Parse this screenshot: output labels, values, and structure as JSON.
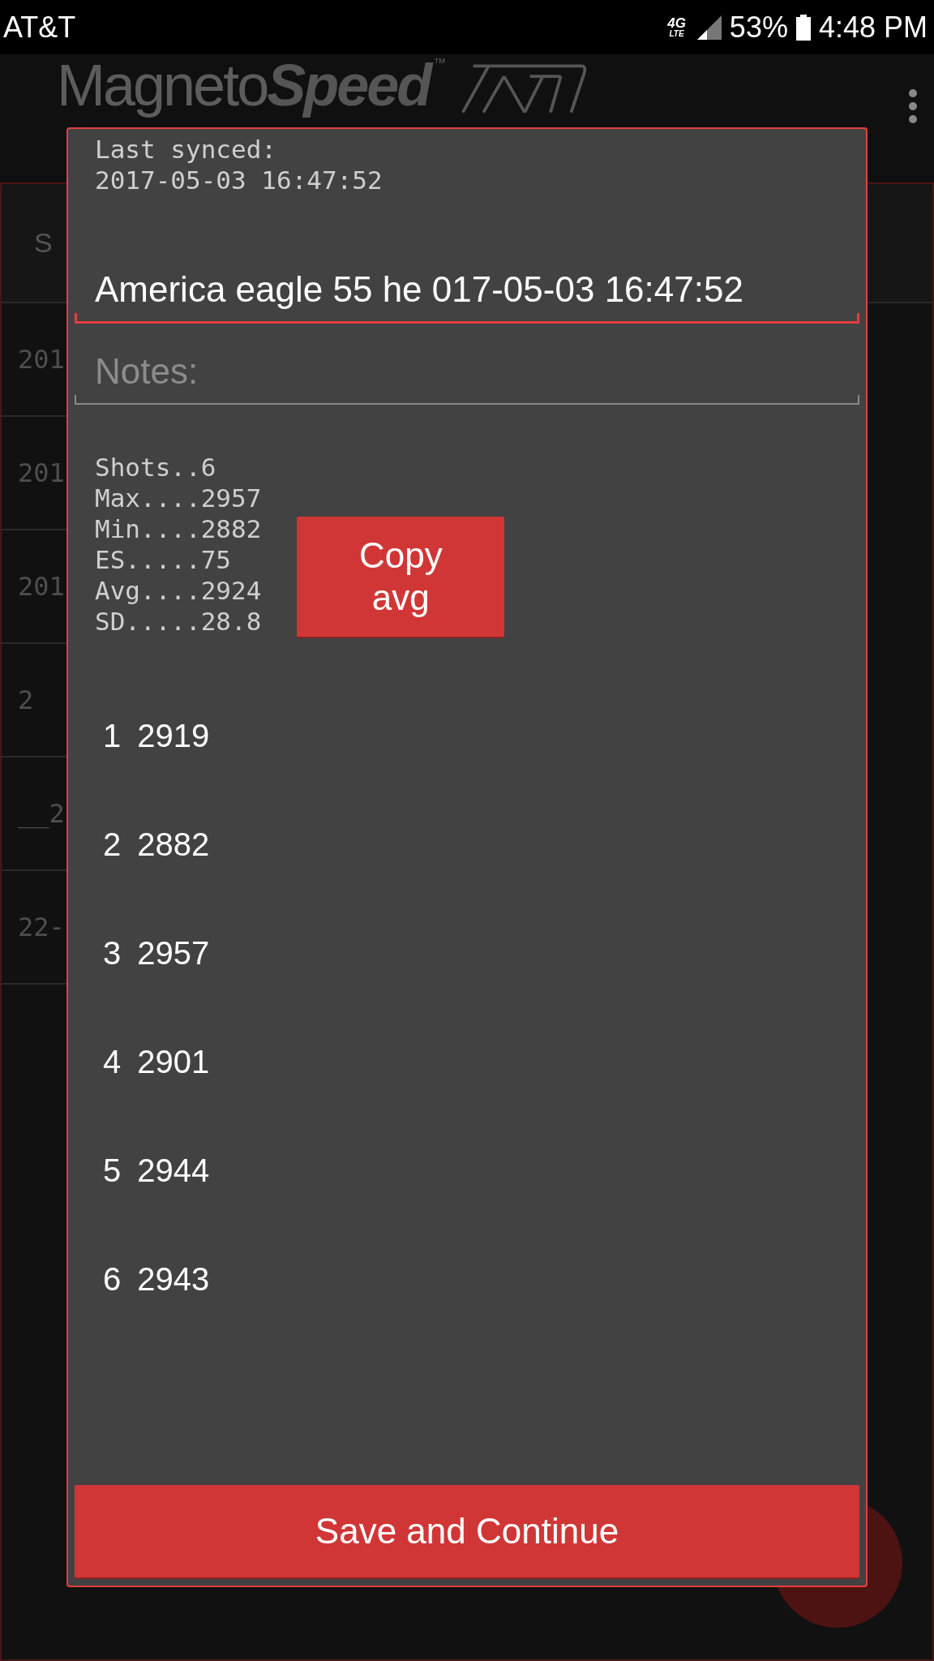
{
  "status_bar": {
    "carrier": "AT&T",
    "network": "4G",
    "network_sub": "LTE",
    "battery": "53%",
    "time": "4:48 PM"
  },
  "app_bar": {
    "logo": "Magneto**Speed**",
    "logo_mark": "™"
  },
  "background_list": {
    "header": "S",
    "rows": [
      "201",
      "201",
      "201",
      "2",
      "__2",
      "22-"
    ]
  },
  "dialog": {
    "sync_label": "Last synced:",
    "sync_time": "2017-05-03 16:47:52",
    "name_field": {
      "value": "America eagle 55 he 017-05-03 16:47:52"
    },
    "notes_field": {
      "placeholder": "Notes:"
    },
    "stats": [
      "Shots..6",
      "Max....2957",
      "Min....2882",
      "ES.....75",
      "Avg....2924",
      "SD.....28.8"
    ],
    "copy_button": "Copy\navg",
    "shots": [
      {
        "number": "1",
        "velocity": "2919"
      },
      {
        "number": "2",
        "velocity": "2882"
      },
      {
        "number": "3",
        "velocity": "2957"
      },
      {
        "number": "4",
        "velocity": "2901"
      },
      {
        "number": "5",
        "velocity": "2944"
      },
      {
        "number": "6",
        "velocity": "2943"
      }
    ],
    "save_button": "Save and Continue"
  }
}
